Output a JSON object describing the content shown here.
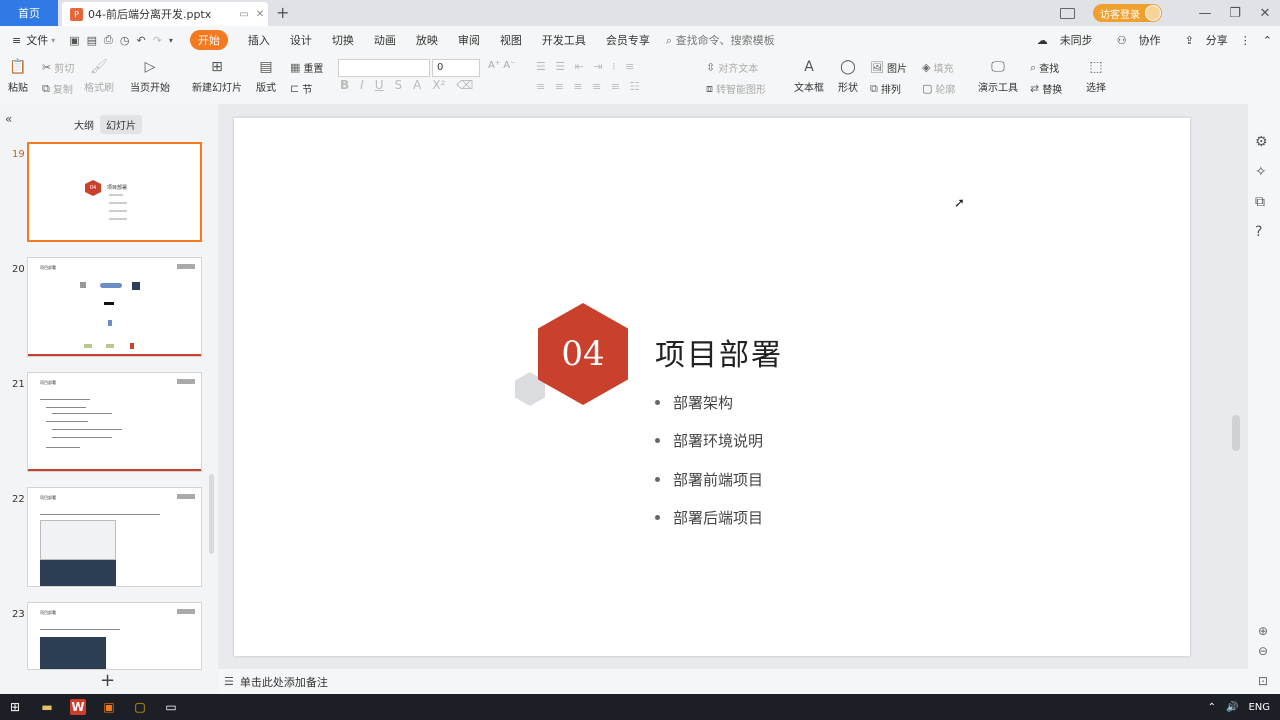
{
  "titlebar": {
    "home_tab": "首页",
    "doc_tab": "04-前后端分离开发.pptx",
    "login_btn": "访客登录"
  },
  "menubar": {
    "file_label": "文件",
    "tabs": [
      "开始",
      "插入",
      "设计",
      "切换",
      "动画",
      "放映",
      "审阅",
      "视图",
      "开发工具",
      "会员专享"
    ],
    "active_tab": "开始",
    "search_placeholder": "查找命令、搜索模板",
    "unsync": "未同步",
    "collab": "协作",
    "share": "分享"
  },
  "ribbon": {
    "paste": "粘贴",
    "cut": "剪切",
    "copy": "复制",
    "format_painter": "格式刷",
    "from_current": "当页开始",
    "new_slide": "新建幻灯片",
    "layout": "版式",
    "section": "节",
    "reset": "重置",
    "font_size": "0",
    "text_box": "文本框",
    "shape": "形状",
    "picture": "图片",
    "fill": "填充",
    "arrange": "排列",
    "outline": "轮廓",
    "find": "查找",
    "replace": "替换",
    "select": "选择",
    "present_tools": "演示工具",
    "align_text": "对齐文本",
    "smart_art": "转智能图形"
  },
  "leftpanel": {
    "tab_outline": "大纲",
    "tab_slides": "幻灯片",
    "thumbs": [
      {
        "num": "19",
        "hex": "04",
        "title": "项目部署"
      },
      {
        "num": "20",
        "hdr": "项目部署"
      },
      {
        "num": "21",
        "hdr": "项目部署"
      },
      {
        "num": "22",
        "hdr": "项目部署"
      },
      {
        "num": "23",
        "hdr": "项目部署"
      }
    ]
  },
  "slide": {
    "number": "04",
    "title": "项目部署",
    "bullets": [
      "部署架构",
      "部署环境说明",
      "部署前端项目",
      "部署后端项目"
    ]
  },
  "notes": {
    "placeholder": "单击此处添加备注"
  },
  "taskbar": {
    "lang": "ENG"
  },
  "colors": {
    "accent_orange": "#f4791f",
    "hex_red": "#c9402d",
    "home_blue": "#2f7ae5"
  }
}
